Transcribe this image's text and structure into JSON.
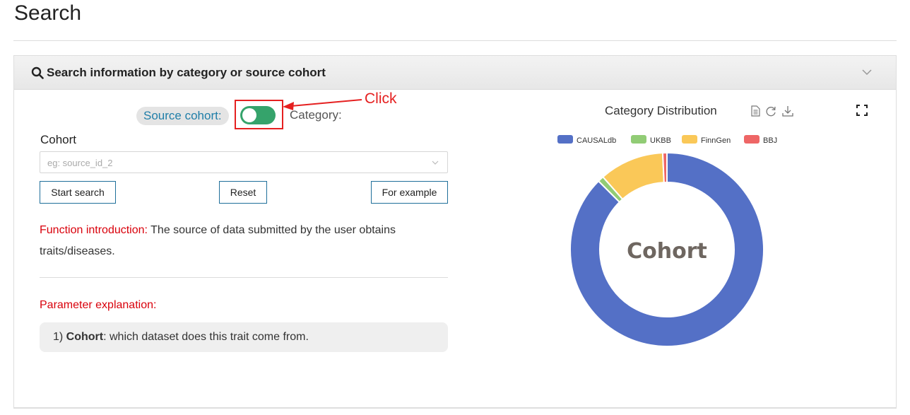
{
  "page": {
    "title": "Search"
  },
  "panel": {
    "title": "Search information by category or source cohort"
  },
  "toggle": {
    "source_label": "Source cohort:",
    "category_label": "Category:",
    "state": "on"
  },
  "annotation": {
    "text": "Click"
  },
  "cohort": {
    "label": "Cohort",
    "placeholder": "eg: source_id_2"
  },
  "buttons": {
    "start": "Start search",
    "reset": "Reset",
    "example": "For example"
  },
  "intro": {
    "prefix": "Function introduction:",
    "body": " The source of data submitted by the user obtains traits/diseases."
  },
  "params": {
    "title": "Parameter explanation:",
    "num": "1) ",
    "name": "Cohort",
    "desc": ": which dataset does this trait come from."
  },
  "colors": {
    "toggle_on": "#35a36b",
    "annotation": "#e52020",
    "intro_red": "#d9000b",
    "button_border": "#1f6f9a"
  },
  "chart_data": {
    "type": "pie",
    "title": "Category Distribution",
    "center_label": "Cohort",
    "legend_position": "top",
    "toolbox": [
      "data-view-icon",
      "refresh-icon",
      "download-icon",
      "fullscreen-icon"
    ],
    "series": [
      {
        "name": "CAUSALdb",
        "value": 87.5,
        "color": "#5470c6"
      },
      {
        "name": "UKBB",
        "value": 1.0,
        "color": "#91cc75"
      },
      {
        "name": "FinnGen",
        "value": 10.8,
        "color": "#fac858"
      },
      {
        "name": "BBJ",
        "value": 0.7,
        "color": "#ee6666"
      }
    ]
  }
}
